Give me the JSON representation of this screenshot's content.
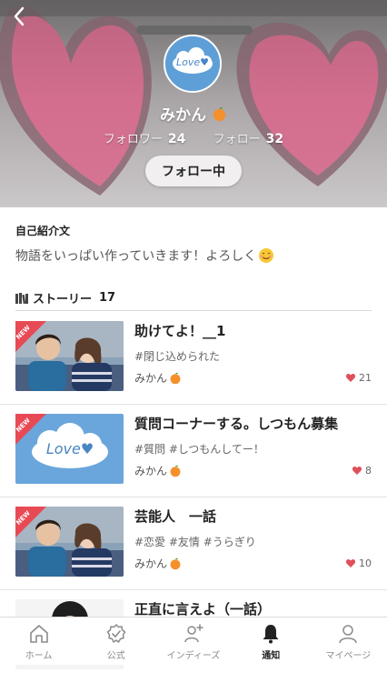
{
  "profile": {
    "name": "みかん",
    "name_emoji": "orange-emoji",
    "avatar_text": "Love♥",
    "followers_label": "フォロワー",
    "followers_count": "24",
    "following_label": "フォロー",
    "following_count": "32",
    "follow_button_label": "フォロー中"
  },
  "bio": {
    "title": "自己紹介文",
    "text": "物語をいっぱい作っていきます！よろしく"
  },
  "stories_section": {
    "label": "ストーリー",
    "count": "17"
  },
  "stories": [
    {
      "title": "助けてよ！__1",
      "tags": "#閉じ込められた",
      "author": "みかん",
      "likes": "21",
      "badge": "NEW",
      "thumb": "couple-photo"
    },
    {
      "title": "質問コーナーする。しつもん募集",
      "tags": "#質問 #しつもんしてー！",
      "author": "みかん",
      "likes": "8",
      "badge": "NEW",
      "thumb": "love-cloud"
    },
    {
      "title": "芸能人　一話",
      "tags": "#恋愛 #友情 #うらぎり",
      "author": "みかん",
      "likes": "10",
      "badge": "NEW",
      "thumb": "couple-photo"
    },
    {
      "title": "正直に言えよ（一話）",
      "tags": "",
      "author": "",
      "likes": "",
      "badge": "",
      "thumb": "person-photo"
    }
  ],
  "nav": [
    {
      "label": "ホーム",
      "icon": "home-icon"
    },
    {
      "label": "公式",
      "icon": "official-badge-icon"
    },
    {
      "label": "インディーズ",
      "icon": "indies-icon"
    },
    {
      "label": "通知",
      "icon": "bell-icon",
      "active": true
    },
    {
      "label": "マイページ",
      "icon": "user-icon"
    }
  ],
  "colors": {
    "heart": "#e0505a",
    "badge": "#e84a55",
    "sky": "#6fa8dc"
  }
}
